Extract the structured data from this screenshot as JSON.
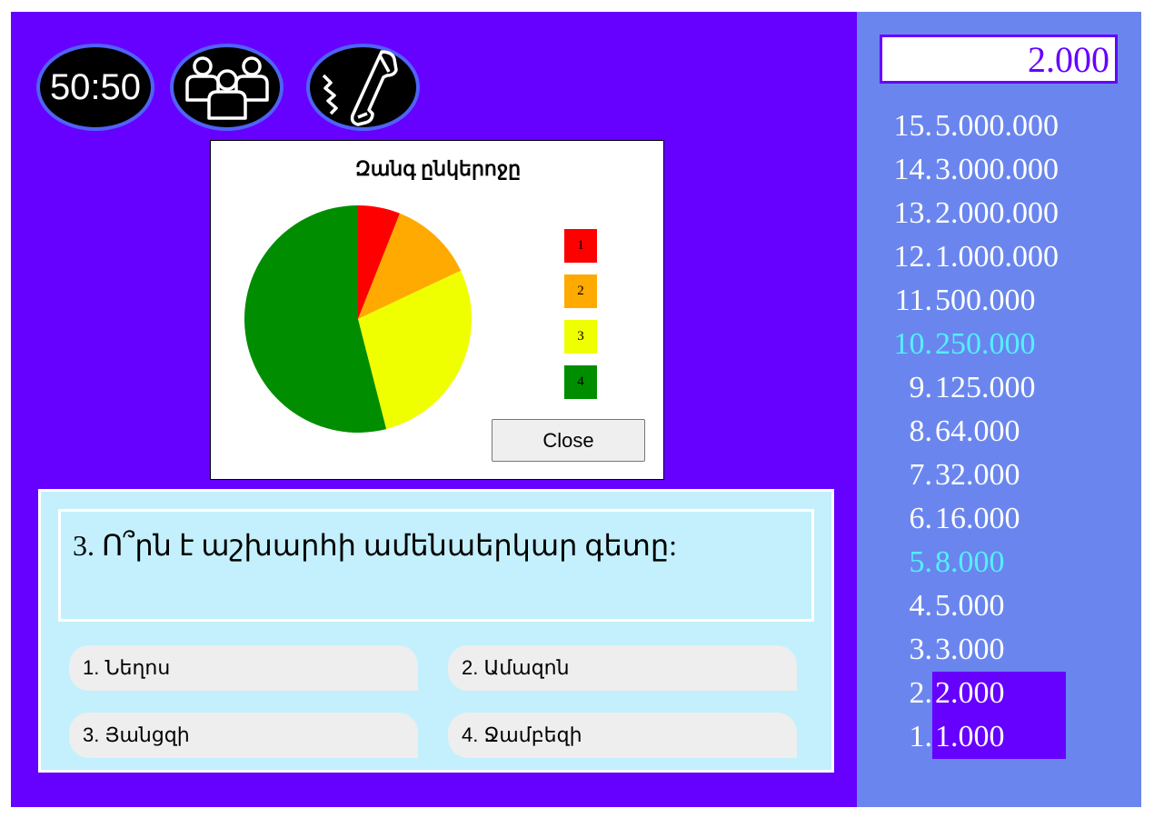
{
  "lifelines": {
    "fifty_fifty": {
      "label": "50:50",
      "icon": "fifty-fifty-icon"
    },
    "audience": {
      "icon": "audience-icon"
    },
    "phone": {
      "icon": "phone-icon"
    }
  },
  "popup": {
    "title": "Զանգ ընկերոջը",
    "close_label": "Close",
    "chart_data": {
      "type": "pie",
      "title": "Զանգ ընկերոջը",
      "categories": [
        "1",
        "2",
        "3",
        "4"
      ],
      "values": [
        6,
        12,
        28,
        54
      ],
      "colors": [
        "#ff0000",
        "#ffaa00",
        "#f0ff00",
        "#008e00"
      ],
      "legend_placement": "right"
    }
  },
  "question": {
    "text": "3. Ո՞րն է աշխարհի ամենաերկար գետը:",
    "answers": [
      "1. Նեղոս",
      "2. Ամազոն",
      "3. Յանցզի",
      "4. Ջամբեզի"
    ]
  },
  "sidebar": {
    "current_prize": "2.000",
    "prizes": [
      {
        "num": "15.",
        "amount": "5.000.000"
      },
      {
        "num": "14.",
        "amount": "3.000.000"
      },
      {
        "num": "13.",
        "amount": "2.000.000"
      },
      {
        "num": "12.",
        "amount": "1.000.000"
      },
      {
        "num": "11.",
        "amount": "500.000"
      },
      {
        "num": "10.",
        "amount": "250.000"
      },
      {
        "num": "9.",
        "amount": "125.000"
      },
      {
        "num": "8.",
        "amount": "64.000"
      },
      {
        "num": "7.",
        "amount": "32.000"
      },
      {
        "num": "6.",
        "amount": "16.000"
      },
      {
        "num": "5.",
        "amount": "8.000"
      },
      {
        "num": "4.",
        "amount": "5.000"
      },
      {
        "num": "3.",
        "amount": "3.000"
      },
      {
        "num": "2.",
        "amount": "2.000"
      },
      {
        "num": "1.",
        "amount": "1.000"
      }
    ]
  },
  "colors": {
    "game_bg": "#6600ff",
    "sidebar_bg": "#6a86ee",
    "milestone": "#55efff",
    "panel_bg": "#c3f0fc"
  }
}
